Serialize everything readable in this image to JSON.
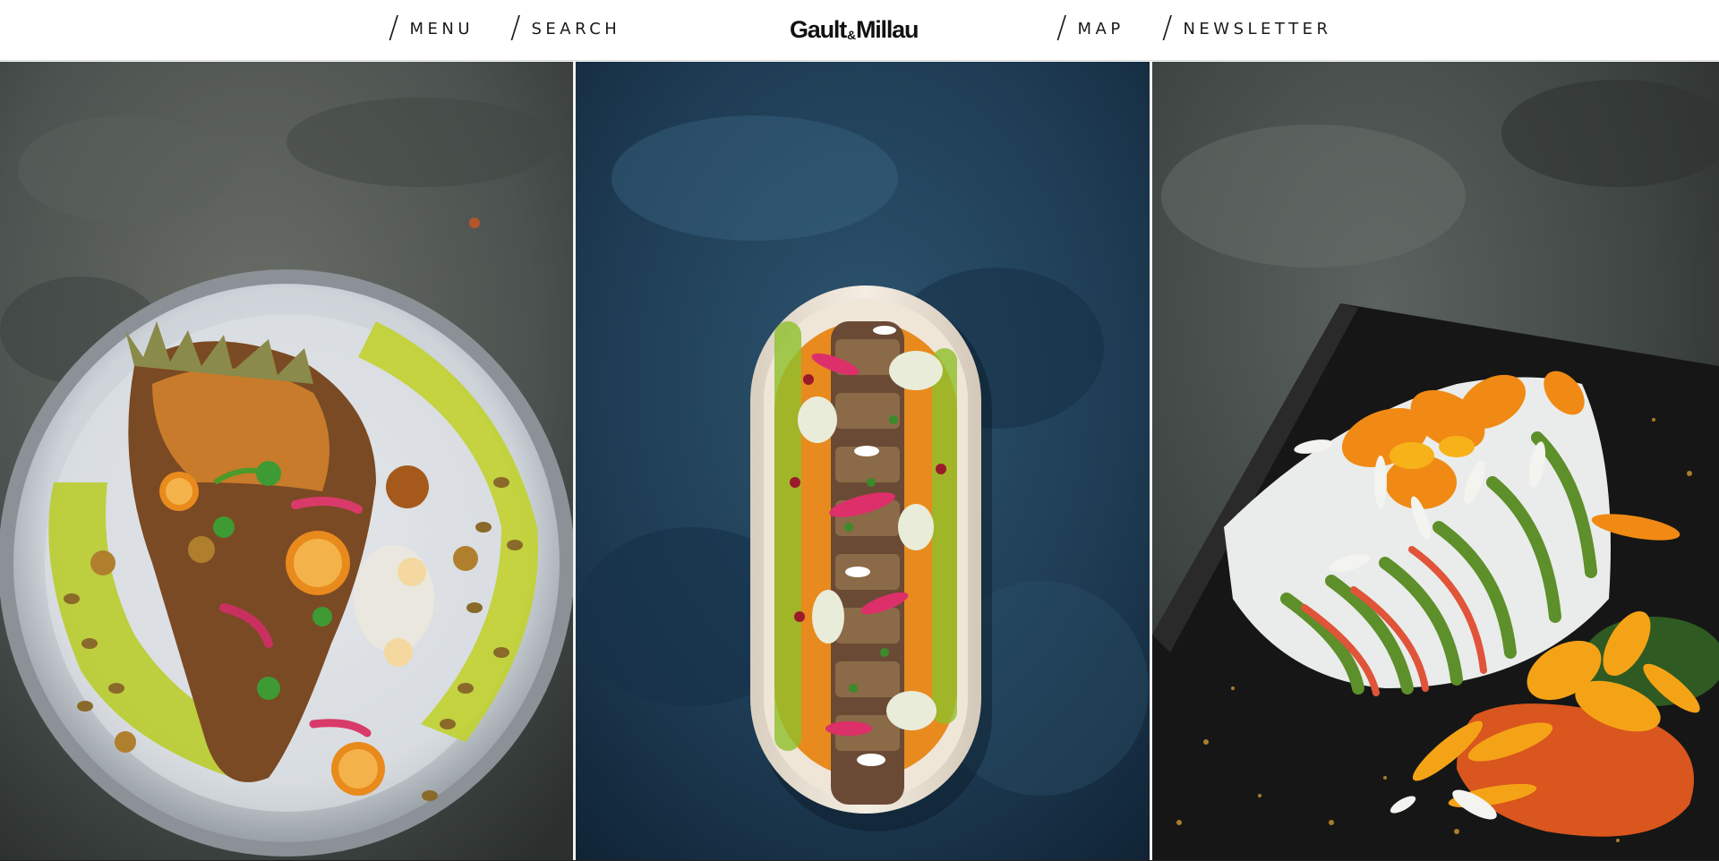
{
  "header": {
    "nav_left": [
      {
        "label": "MENU"
      },
      {
        "label": "SEARCH"
      }
    ],
    "logo": {
      "part1": "Gault",
      "amp": "&",
      "part2": "Millau"
    },
    "nav_right": [
      {
        "label": "MAP"
      },
      {
        "label": "NEWSLETTER"
      }
    ],
    "slash": "/"
  },
  "panels": [
    {
      "subject": "round-plate-roasted-carrots",
      "background": "#4a4f4c"
    },
    {
      "subject": "oval-dish-tuna-tataki",
      "background": "#1f3a52"
    },
    {
      "subject": "black-slate-flower-dessert",
      "background": "#3d4240"
    }
  ],
  "colors": {
    "accent_green": "#b9cc2c",
    "accent_orange": "#f07a10",
    "text": "#1a1a1a"
  }
}
